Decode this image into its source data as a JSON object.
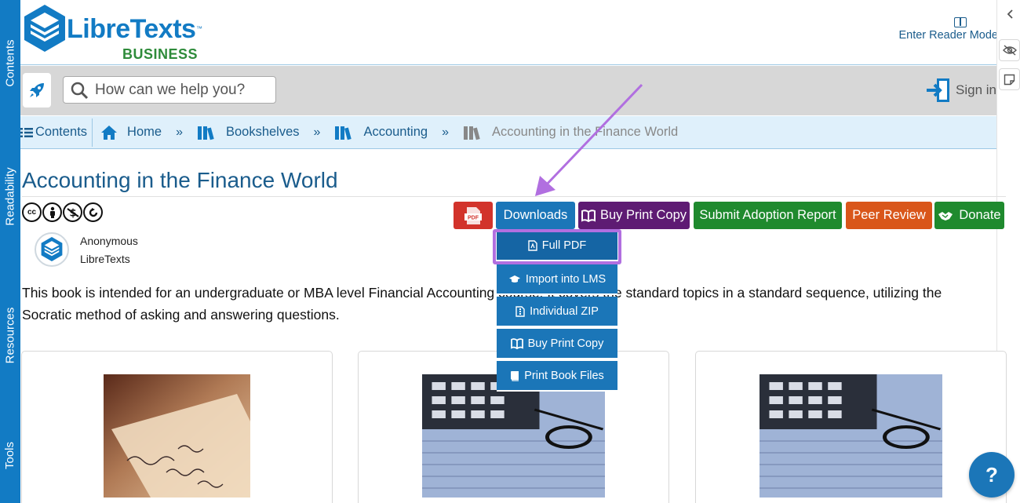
{
  "rail": {
    "tabs": [
      "Contents",
      "Readability",
      "Resources",
      "Tools"
    ]
  },
  "header": {
    "logo_word": "LibreTexts",
    "logo_tm": "™",
    "logo_sub": "BUSINESS",
    "reader_mode": "Enter Reader Mode"
  },
  "search": {
    "placeholder": "How can we help you?"
  },
  "account": {
    "signin": "Sign in"
  },
  "breadcrumbs": {
    "contents": "Contents",
    "items": [
      "Home",
      "Bookshelves",
      "Accounting",
      "Accounting in the Finance World"
    ],
    "separator": "»"
  },
  "page": {
    "title": "Accounting in the Finance World",
    "license_icons": [
      "cc-icon",
      "by-icon",
      "nc-icon",
      "sa-icon"
    ],
    "author_name": "Anonymous",
    "author_org": "LibreTexts",
    "description": "This book is intended for an undergraduate or MBA level Financial Accounting course. It covers the standard topics in a standard sequence, utilizing the Socratic method of asking and answering questions."
  },
  "actions": {
    "pdf_icon_label": "PDF",
    "downloads": "Downloads",
    "buy_print": "Buy Print Copy",
    "adoption": "Submit Adoption Report",
    "peer_review": "Peer Review",
    "donate": "Donate"
  },
  "downloads_menu": {
    "items": [
      "Full PDF",
      "Import into LMS",
      "Individual ZIP",
      "Buy Print Copy",
      "Print Book Files"
    ]
  },
  "help": {
    "label": "?"
  },
  "colors": {
    "brand_blue": "#127bc4",
    "title_blue": "#1a5c8c",
    "pdf_red": "#d2332b",
    "downloads_blue": "#1b76b8",
    "print_purple": "#5e1b73",
    "adoption_green": "#1f8a2e",
    "peer_orange": "#d9561a",
    "donate_green": "#1f8a2e",
    "highlight_purple": "#b16fe0"
  }
}
